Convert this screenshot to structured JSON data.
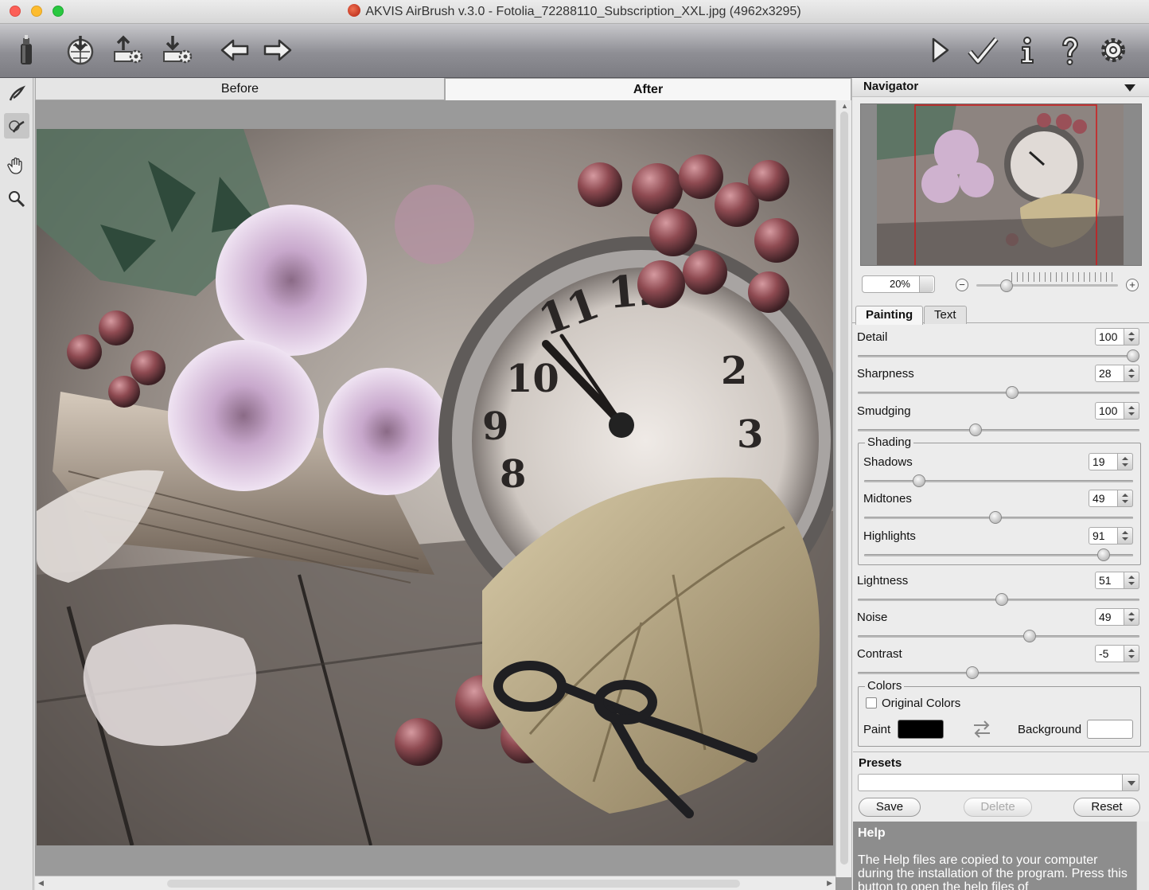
{
  "window": {
    "title": "AKVIS AirBrush v.3.0 - Fotolia_72288110_Subscription_XXL.jpg (4962x3295)"
  },
  "toolbar": {
    "left_icons": [
      "airbrush-can-icon",
      "open-image-icon",
      "export-settings-icon",
      "import-settings-icon",
      "undo-arrow-icon",
      "redo-arrow-icon"
    ],
    "right_icons": [
      "run-icon",
      "apply-checkmark-icon",
      "info-icon",
      "help-icon",
      "preferences-gear-icon"
    ]
  },
  "tools": [
    "airbrush-tool-icon",
    "history-brush-tool-icon",
    "hand-tool-icon",
    "zoom-tool-icon"
  ],
  "view_tabs": {
    "before": "Before",
    "after": "After",
    "active": "After"
  },
  "navigator": {
    "title": "Navigator",
    "zoom": "20%",
    "zoom_out": "−",
    "zoom_in": "+",
    "zoom_level": 0.2
  },
  "settings_tabs": {
    "painting": "Painting",
    "text": "Text",
    "active": "Painting"
  },
  "params": {
    "detail": {
      "label": "Detail",
      "value": "100"
    },
    "sharpness": {
      "label": "Sharpness",
      "value": "28"
    },
    "smudging": {
      "label": "Smudging",
      "value": "100"
    },
    "shadows": {
      "label": "Shadows",
      "value": "19"
    },
    "midtones": {
      "label": "Midtones",
      "value": "49"
    },
    "highlights": {
      "label": "Highlights",
      "value": "91"
    },
    "lightness": {
      "label": "Lightness",
      "value": "51"
    },
    "noise": {
      "label": "Noise",
      "value": "49"
    },
    "contrast": {
      "label": "Contrast",
      "value": "-5"
    }
  },
  "groups": {
    "shading": "Shading",
    "colors": "Colors"
  },
  "colors": {
    "original_colors_label": "Original Colors",
    "original_colors_checked": false,
    "paint_label": "Paint",
    "background_label": "Background",
    "paint_color": "#000000",
    "background_color": "#ffffff"
  },
  "presets": {
    "title": "Presets",
    "selected": "",
    "save": "Save",
    "delete": "Delete",
    "reset": "Reset"
  },
  "help": {
    "title": "Help",
    "text": "The Help files are copied to your computer during the installation of the program. Press this button to open the help files of"
  }
}
